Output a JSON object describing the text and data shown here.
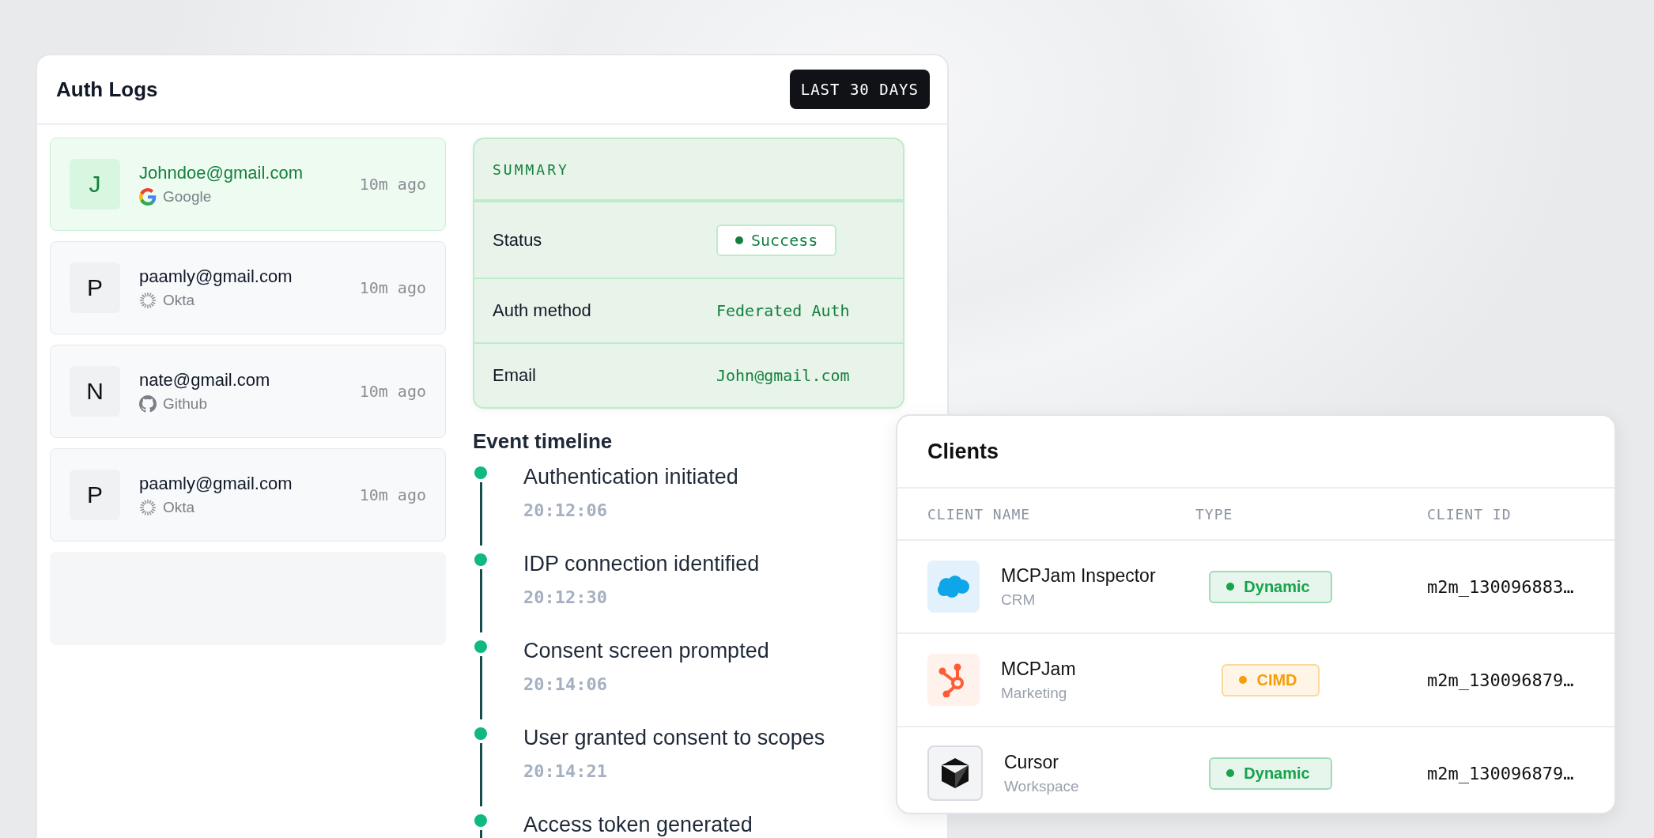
{
  "auth_logs": {
    "title": "Auth Logs",
    "range_button": "LAST 30 DAYS",
    "entries": [
      {
        "initial": "J",
        "email": "Johndoe@gmail.com",
        "provider": {
          "name": "Google",
          "kind": "google"
        },
        "time": "10m ago",
        "selected": true
      },
      {
        "initial": "P",
        "email": "paamly@gmail.com",
        "provider": {
          "name": "Okta",
          "kind": "okta"
        },
        "time": "10m ago",
        "selected": false
      },
      {
        "initial": "N",
        "email": "nate@gmail.com",
        "provider": {
          "name": "Github",
          "kind": "github"
        },
        "time": "10m ago",
        "selected": false
      },
      {
        "initial": "P",
        "email": "paamly@gmail.com",
        "provider": {
          "name": "Okta",
          "kind": "okta"
        },
        "time": "10m ago",
        "selected": false
      }
    ],
    "summary": {
      "title": "SUMMARY",
      "rows": [
        {
          "label": "Status",
          "value": "Success",
          "kind": "badge"
        },
        {
          "label": "Auth method",
          "value": "Federated Auth",
          "kind": "text"
        },
        {
          "label": "Email",
          "value": "John@gmail.com",
          "kind": "text"
        }
      ]
    },
    "timeline": {
      "title": "Event timeline",
      "events": [
        {
          "title": "Authentication initiated",
          "time": "20:12:06"
        },
        {
          "title": "IDP connection identified",
          "time": "20:12:30"
        },
        {
          "title": "Consent screen prompted",
          "time": "20:14:06"
        },
        {
          "title": "User granted consent to scopes",
          "time": "20:14:21"
        },
        {
          "title": "Access token generated"
        }
      ]
    }
  },
  "clients": {
    "title": "Clients",
    "columns": [
      "CLIENT NAME",
      "TYPE",
      "CLIENT ID"
    ],
    "rows": [
      {
        "name": "MCPJam Inspector",
        "category": "CRM",
        "kind": "cloud",
        "type": "Dynamic",
        "color": "#16a34a",
        "client_id": "m2m_130096883…"
      },
      {
        "name": "MCPJam",
        "category": "Marketing",
        "kind": "hub",
        "type": "CIMD",
        "color": "#f59e0b",
        "client_id": "m2m_130096879…"
      },
      {
        "name": "Cursor",
        "category": "Workspace",
        "kind": "cube",
        "type": "Dynamic",
        "color": "#16a34a",
        "client_id": "m2m_130096879…"
      }
    ]
  }
}
